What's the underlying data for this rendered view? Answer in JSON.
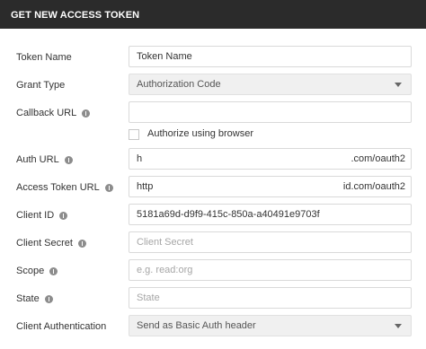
{
  "dialog": {
    "title": "GET NEW ACCESS TOKEN"
  },
  "fields": {
    "token_name": {
      "label": "Token Name",
      "value": "Token Name"
    },
    "grant_type": {
      "label": "Grant Type",
      "value": "Authorization Code"
    },
    "callback_url": {
      "label": "Callback URL",
      "value": ""
    },
    "authorize_browser": {
      "label": "Authorize using browser",
      "checked": false
    },
    "auth_url": {
      "label": "Auth URL",
      "value_start": "h",
      "value_end": ".com/oauth2"
    },
    "access_token_url": {
      "label": "Access Token URL",
      "value_start": "http",
      "value_end": "id.com/oauth2"
    },
    "client_id": {
      "label": "Client ID",
      "value": "5181a69d-d9f9-415c-850a-a40491e9703f"
    },
    "client_secret": {
      "label": "Client Secret",
      "placeholder": "Client Secret"
    },
    "scope": {
      "label": "Scope",
      "placeholder": "e.g. read:org"
    },
    "state": {
      "label": "State",
      "placeholder": "State"
    },
    "client_authentication": {
      "label": "Client Authentication",
      "value": "Send as Basic Auth header"
    }
  },
  "icons": {
    "info": "info-icon",
    "dropdown": "chevron-down-icon"
  },
  "colors": {
    "header_bg": "#2b2b2b",
    "field_border": "#d9d9d9",
    "select_bg": "#f0f0f0"
  }
}
